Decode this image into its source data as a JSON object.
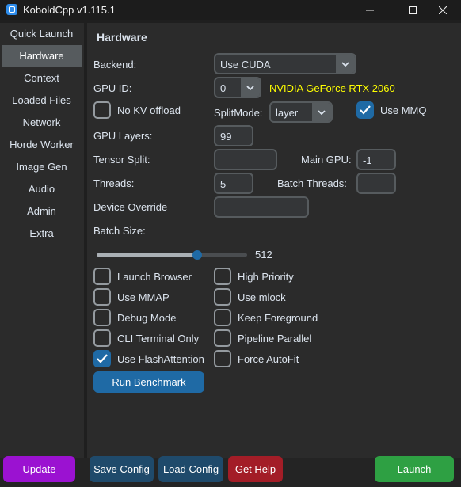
{
  "window": {
    "title": "KoboldCpp v1.115.1"
  },
  "sidebar": {
    "items": [
      {
        "label": "Quick Launch"
      },
      {
        "label": "Hardware"
      },
      {
        "label": "Context"
      },
      {
        "label": "Loaded Files"
      },
      {
        "label": "Network"
      },
      {
        "label": "Horde Worker"
      },
      {
        "label": "Image Gen"
      },
      {
        "label": "Audio"
      },
      {
        "label": "Admin"
      },
      {
        "label": "Extra"
      }
    ],
    "active": "Hardware"
  },
  "hardware": {
    "heading": "Hardware",
    "backend_label": "Backend:",
    "backend_value": "Use CUDA",
    "gpu_id_label": "GPU ID:",
    "gpu_id_value": "0",
    "gpu_name": "NVIDIA GeForce RTX 2060",
    "no_kv_offload_label": "No KV offload",
    "no_kv_offload_checked": false,
    "split_mode_label": "SplitMode:",
    "split_mode_value": "layer",
    "use_mmq_label": "Use MMQ",
    "use_mmq_checked": true,
    "gpu_layers_label": "GPU Layers:",
    "gpu_layers_value": "99",
    "tensor_split_label": "Tensor Split:",
    "tensor_split_value": "",
    "main_gpu_label": "Main GPU:",
    "main_gpu_value": "-1",
    "threads_label": "Threads:",
    "threads_value": "5",
    "batch_threads_label": "Batch Threads:",
    "batch_threads_value": "",
    "device_override_label": "Device Override",
    "device_override_value": "",
    "batch_size_label": "Batch Size:",
    "batch_size_value": "512",
    "batch_size_slider_fraction": 0.67,
    "left_checks": [
      {
        "label": "Launch Browser",
        "checked": false
      },
      {
        "label": "Use MMAP",
        "checked": false
      },
      {
        "label": "Debug Mode",
        "checked": false
      },
      {
        "label": "CLI Terminal Only",
        "checked": false
      },
      {
        "label": "Use FlashAttention",
        "checked": true
      }
    ],
    "right_checks": [
      {
        "label": "High Priority",
        "checked": false
      },
      {
        "label": "Use mlock",
        "checked": false
      },
      {
        "label": "Keep Foreground",
        "checked": false
      },
      {
        "label": "Pipeline Parallel",
        "checked": false
      },
      {
        "label": "Force AutoFit",
        "checked": false
      }
    ],
    "benchmark_label": "Run Benchmark"
  },
  "footer": {
    "update_label": "Update",
    "save_label": "Save Config",
    "load_label": "Load Config",
    "help_label": "Get Help",
    "launch_label": "Launch"
  },
  "colors": {
    "accent": "#1f6aa5",
    "gpu_name": "#ffff00",
    "update": "#9b12d1",
    "save_load": "#1f4a6b",
    "help": "#a31d27",
    "launch": "#2ea043"
  },
  "icons": [
    "app-icon",
    "minimize-icon",
    "maximize-icon",
    "close-icon",
    "chevron-down-icon",
    "checkmark-icon"
  ]
}
